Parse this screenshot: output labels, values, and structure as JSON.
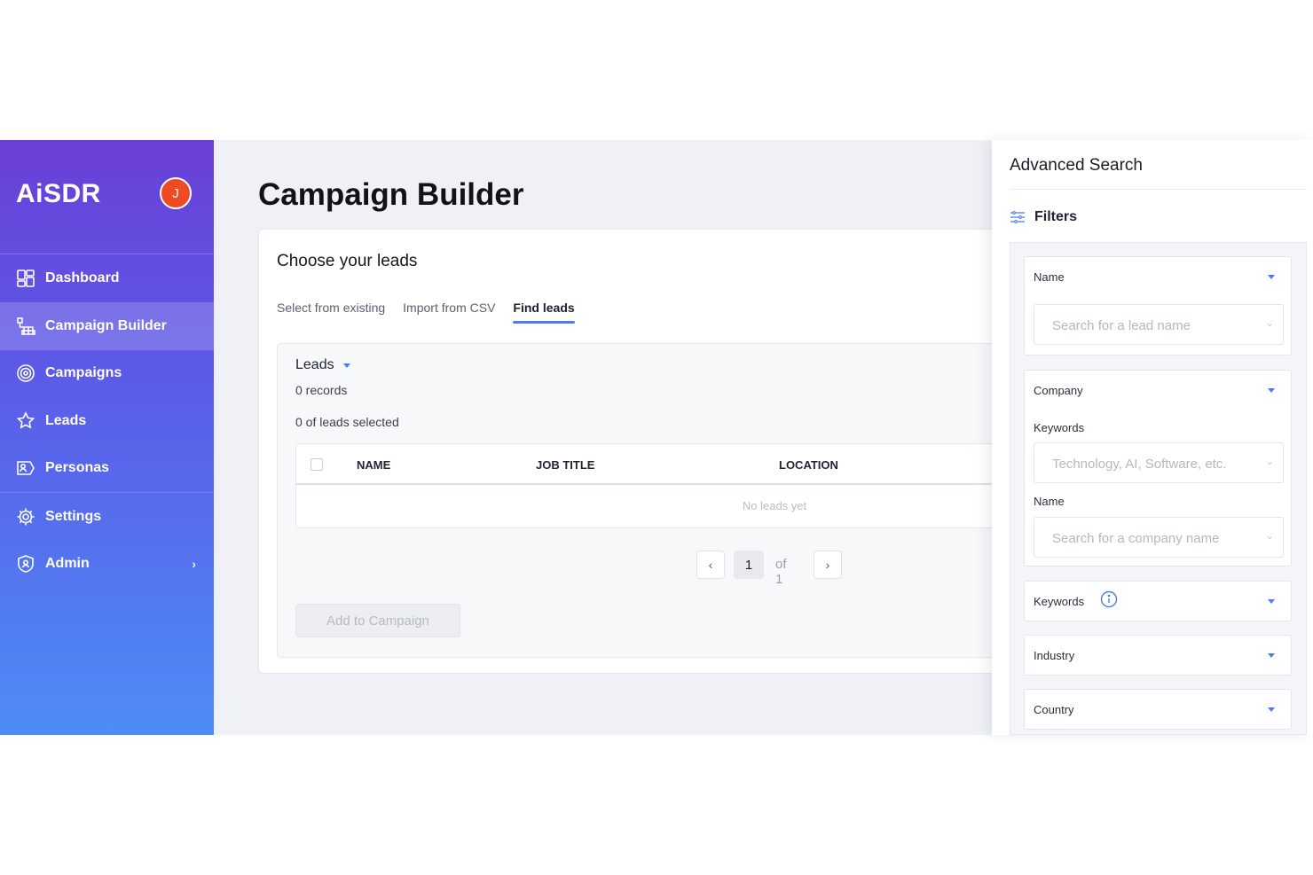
{
  "brand": "AiSDR",
  "user": {
    "avatar_initial": "J"
  },
  "sidebar": {
    "items": [
      {
        "label": "Dashboard",
        "icon": "dashboard-icon"
      },
      {
        "label": "Campaign Builder",
        "icon": "campaign-builder-icon",
        "active": true
      },
      {
        "label": "Campaigns",
        "icon": "target-icon"
      },
      {
        "label": "Leads",
        "icon": "star-person-icon"
      },
      {
        "label": "Personas",
        "icon": "persona-icon"
      },
      {
        "label": "Settings",
        "icon": "gear-icon"
      },
      {
        "label": "Admin",
        "icon": "admin-shield-icon",
        "has_submenu": true
      }
    ]
  },
  "main": {
    "title": "Campaign Builder",
    "card": {
      "title": "Choose your leads",
      "tabs": [
        {
          "label": "Select from existing"
        },
        {
          "label": "Import from CSV"
        },
        {
          "label": "Find leads",
          "active": true
        }
      ],
      "leads_header": "Leads",
      "records": "0 records",
      "selected": "0 of leads selected",
      "columns": [
        "NAME",
        "JOB TITLE",
        "LOCATION"
      ],
      "empty_text": "No leads yet",
      "pagination": {
        "current": "1",
        "of_text": "of 1"
      },
      "add_button": "Add to Campaign"
    }
  },
  "panel": {
    "title": "Advanced Search",
    "filters_label": "Filters",
    "name_section": {
      "label": "Name",
      "placeholder": "Search for a lead name"
    },
    "company_section": {
      "label": "Company",
      "keywords_label": "Keywords",
      "keywords_placeholder": "Technology, AI, Software, etc.",
      "name_label": "Name",
      "name_placeholder": "Search for a company name"
    },
    "keywords_section": {
      "label": "Keywords"
    },
    "industry_section": {
      "label": "Industry"
    },
    "country_section": {
      "label": "Country"
    }
  },
  "colors": {
    "accent": "#4f7bf2",
    "avatar": "#ef4a23"
  }
}
